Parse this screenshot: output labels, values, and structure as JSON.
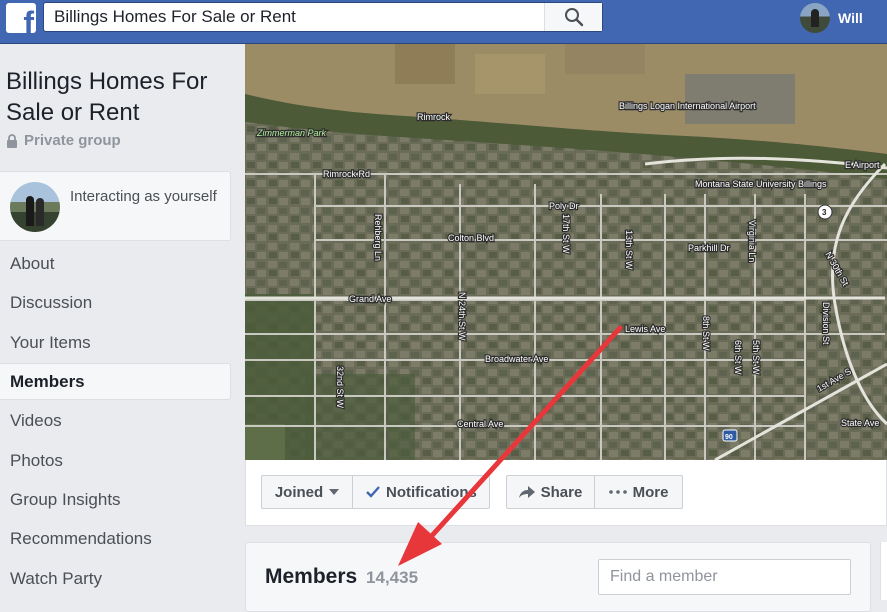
{
  "topbar": {
    "logo_glyph": "f",
    "search_value": "Billings Homes For Sale or Rent",
    "user_name": "Will"
  },
  "group": {
    "title": "Billings Homes For Sale or Rent",
    "privacy": "Private group",
    "interacting": "Interacting as yourself"
  },
  "nav": {
    "items": [
      {
        "label": "About"
      },
      {
        "label": "Discussion"
      },
      {
        "label": "Your Items"
      },
      {
        "label": "Members"
      },
      {
        "label": "Videos"
      },
      {
        "label": "Photos"
      },
      {
        "label": "Group Insights"
      },
      {
        "label": "Recommendations"
      },
      {
        "label": "Watch Party"
      }
    ],
    "active": "Members"
  },
  "cover_map": {
    "labels": [
      "Rimrock",
      "Zimmerman Park",
      "Billings Logan International Airport",
      "Rimrock Rd",
      "Montana State University Billings",
      "E Airport",
      "Poly Dr",
      "17th St W",
      "Colton Blvd",
      "Rehberg Ln",
      "13th St W",
      "Parkhill Dr",
      "Virginia Ln",
      "N 30th St",
      "Grand Ave",
      "N 24th St W",
      "Lewis Ave",
      "8th St W",
      "6th St W",
      "5th St W",
      "Division St",
      "Broadwater Ave",
      "1st Ave S",
      "32nd St W",
      "Central Ave",
      "State Ave",
      "3",
      "90"
    ]
  },
  "actions": {
    "joined": "Joined",
    "notifications": "Notifications",
    "share": "Share",
    "more": "More"
  },
  "members": {
    "title": "Members",
    "count": "14,435",
    "find_placeholder": "Find a member"
  },
  "colors": {
    "brand": "#4267b2",
    "arrow": "#e8373a",
    "check": "#4267b2"
  }
}
